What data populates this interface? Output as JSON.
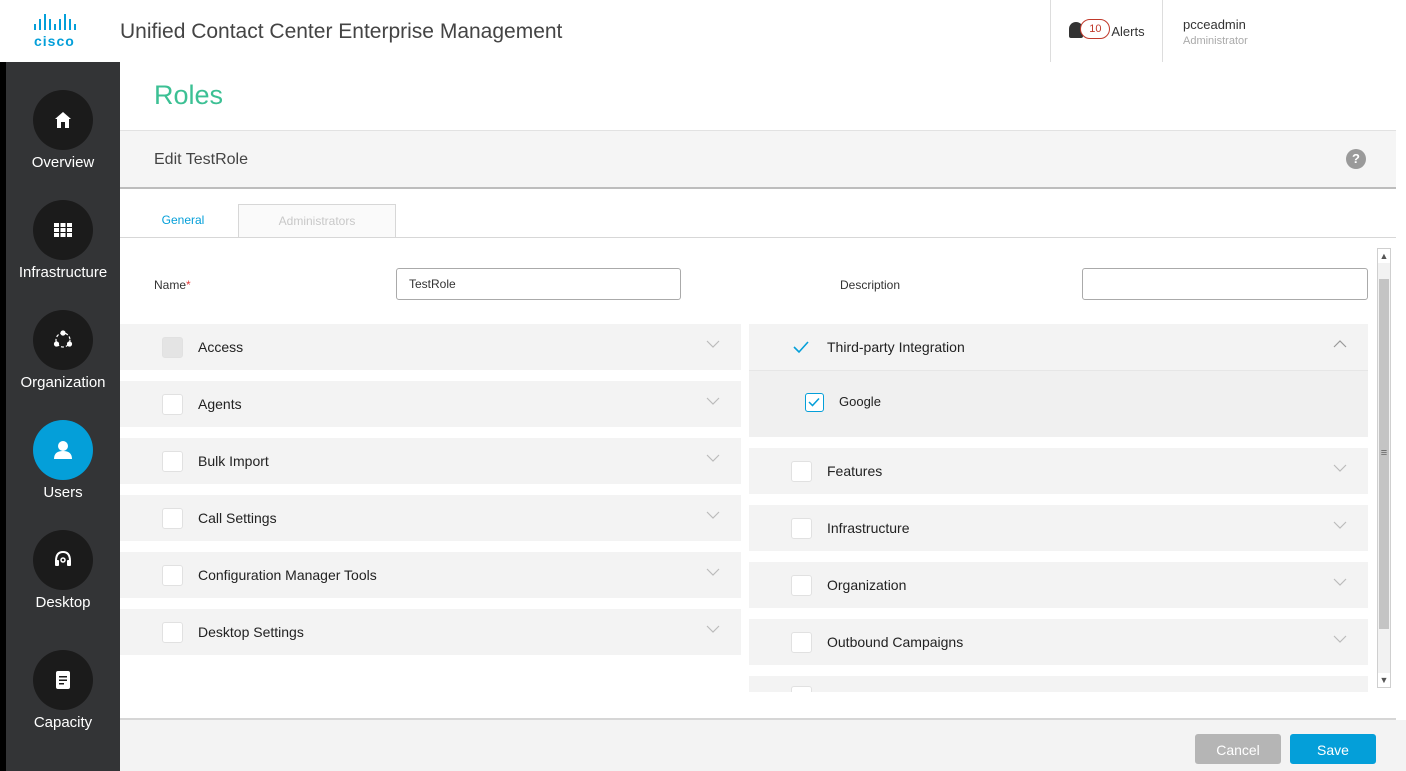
{
  "header": {
    "brand": "cisco",
    "app_title": "Unified Contact Center Enterprise Management",
    "alerts": {
      "count": "10",
      "label": "Alerts",
      "icon": "bell-icon"
    },
    "user": {
      "name": "pcceadmin",
      "role": "Administrator"
    }
  },
  "sidebar": {
    "items": [
      {
        "label": "Overview",
        "icon": "home-icon",
        "active": false
      },
      {
        "label": "Infrastructure",
        "icon": "grid-icon",
        "active": false
      },
      {
        "label": "Organization",
        "icon": "org-icon",
        "active": false
      },
      {
        "label": "Users",
        "icon": "user-icon",
        "active": true
      },
      {
        "label": "Desktop",
        "icon": "headset-icon",
        "active": false
      },
      {
        "label": "Capacity",
        "icon": "document-icon",
        "active": false
      }
    ]
  },
  "page": {
    "title": "Roles",
    "subtitle": "Edit TestRole",
    "help": "?"
  },
  "tabs": [
    {
      "label": "General",
      "active": true
    },
    {
      "label": "Administrators",
      "active": false
    }
  ],
  "form": {
    "name_label": "Name",
    "required_mark": "*",
    "name_value": "TestRole",
    "description_label": "Description",
    "description_value": ""
  },
  "left_sections": [
    {
      "label": "Access",
      "checked": false,
      "disabled": true
    },
    {
      "label": "Agents",
      "checked": false,
      "disabled": false
    },
    {
      "label": "Bulk Import",
      "checked": false,
      "disabled": false
    },
    {
      "label": "Call Settings",
      "checked": false,
      "disabled": false
    },
    {
      "label": "Configuration Manager Tools",
      "checked": false,
      "disabled": false
    },
    {
      "label": "Desktop Settings",
      "checked": false,
      "disabled": false
    }
  ],
  "right_sections": [
    {
      "label": "Third-party Integration",
      "checked": true,
      "expanded": true,
      "children": [
        {
          "label": "Google",
          "checked": true
        }
      ]
    },
    {
      "label": "Features",
      "checked": false,
      "expanded": false
    },
    {
      "label": "Infrastructure",
      "checked": false,
      "expanded": false
    },
    {
      "label": "Organization",
      "checked": false,
      "expanded": false
    },
    {
      "label": "Outbound Campaigns",
      "checked": false,
      "expanded": false
    }
  ],
  "footer": {
    "cancel_label": "Cancel",
    "save_label": "Save"
  },
  "colors": {
    "accent": "#049fd9",
    "title_green": "#3cc094",
    "sidebar_bg": "#333436",
    "alert_red": "#c0392b"
  }
}
